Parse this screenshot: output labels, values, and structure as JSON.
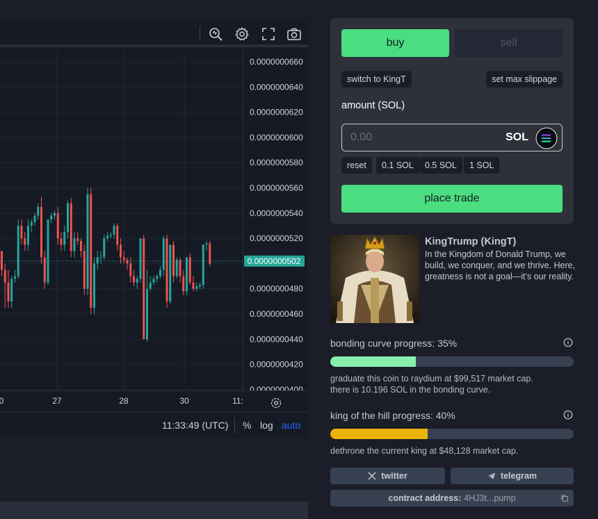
{
  "chart": {
    "price_ticks": [
      "0.0000000660",
      "0.0000000640",
      "0.0000000620",
      "0.0000000600",
      "0.0000000580",
      "0.0000000560",
      "0.0000000540",
      "0.0000000520",
      "0.0000000500",
      "0.0000000480",
      "0.0000000460",
      "0.0000000440",
      "0.0000000420",
      "0.0000000400"
    ],
    "current_price": "0.0000000502",
    "time_labels": [
      "0",
      "27",
      "28",
      "30",
      "11:"
    ],
    "clock": "11:33:49 (UTC)",
    "percent_label": "%",
    "log_label": "log",
    "auto_label": "auto",
    "colors": {
      "up": "#26a69a",
      "down": "#ef5350",
      "price_badge": "#26a69a"
    },
    "icons": [
      "indicator-search-icon",
      "gear-icon",
      "fullscreen-icon",
      "camera-icon"
    ]
  },
  "chart_data": {
    "type": "candlestick",
    "ylim": [
      4e-08,
      6.6e-08
    ],
    "candles": [
      {
        "o": 51.0,
        "h": 51.0,
        "l": 49.0,
        "c": 49.5
      },
      {
        "o": 49.5,
        "h": 50.0,
        "l": 46.5,
        "c": 48.5
      },
      {
        "o": 48.5,
        "h": 49.5,
        "l": 46.5,
        "c": 47.0
      },
      {
        "o": 47.0,
        "h": 49.0,
        "l": 46.5,
        "c": 48.8
      },
      {
        "o": 48.8,
        "h": 49.5,
        "l": 48.5,
        "c": 49.0
      },
      {
        "o": 49.0,
        "h": 53.5,
        "l": 48.8,
        "c": 53.0
      },
      {
        "o": 53.0,
        "h": 53.5,
        "l": 51.5,
        "c": 52.0
      },
      {
        "o": 52.0,
        "h": 52.5,
        "l": 51.0,
        "c": 51.5
      },
      {
        "o": 51.5,
        "h": 53.5,
        "l": 51.0,
        "c": 53.0
      },
      {
        "o": 53.0,
        "h": 53.5,
        "l": 52.5,
        "c": 53.3
      },
      {
        "o": 53.3,
        "h": 54.0,
        "l": 53.0,
        "c": 53.8
      },
      {
        "o": 53.8,
        "h": 54.8,
        "l": 53.5,
        "c": 54.5
      },
      {
        "o": 54.5,
        "h": 55.3,
        "l": 50.0,
        "c": 50.5
      },
      {
        "o": 50.5,
        "h": 51.0,
        "l": 48.0,
        "c": 48.5
      },
      {
        "o": 48.5,
        "h": 53.5,
        "l": 48.3,
        "c": 53.5
      },
      {
        "o": 53.5,
        "h": 54.0,
        "l": 53.2,
        "c": 53.8
      },
      {
        "o": 53.8,
        "h": 54.2,
        "l": 53.5,
        "c": 54.0
      },
      {
        "o": 54.0,
        "h": 54.5,
        "l": 51.5,
        "c": 52.0
      },
      {
        "o": 52.0,
        "h": 52.5,
        "l": 51.0,
        "c": 51.5
      },
      {
        "o": 51.5,
        "h": 53.0,
        "l": 51.0,
        "c": 52.5
      },
      {
        "o": 52.5,
        "h": 55.0,
        "l": 52.0,
        "c": 54.8
      },
      {
        "o": 54.8,
        "h": 55.2,
        "l": 50.5,
        "c": 51.0
      },
      {
        "o": 51.0,
        "h": 52.5,
        "l": 50.5,
        "c": 52.0
      },
      {
        "o": 52.0,
        "h": 52.5,
        "l": 51.5,
        "c": 51.8
      },
      {
        "o": 51.8,
        "h": 52.0,
        "l": 50.5,
        "c": 51.0
      },
      {
        "o": 51.0,
        "h": 51.5,
        "l": 47.5,
        "c": 48.0
      },
      {
        "o": 48.0,
        "h": 56.0,
        "l": 47.5,
        "c": 55.5
      },
      {
        "o": 55.5,
        "h": 56.0,
        "l": 46.0,
        "c": 46.5
      },
      {
        "o": 46.5,
        "h": 50.5,
        "l": 46.0,
        "c": 50.0
      },
      {
        "o": 50.0,
        "h": 51.0,
        "l": 49.5,
        "c": 50.5
      },
      {
        "o": 50.5,
        "h": 51.0,
        "l": 50.0,
        "c": 50.5
      },
      {
        "o": 50.5,
        "h": 52.3,
        "l": 50.3,
        "c": 52.0
      },
      {
        "o": 52.0,
        "h": 52.5,
        "l": 51.8,
        "c": 52.2
      },
      {
        "o": 52.2,
        "h": 52.5,
        "l": 52.0,
        "c": 52.3
      },
      {
        "o": 52.3,
        "h": 53.2,
        "l": 52.0,
        "c": 53.0
      },
      {
        "o": 53.0,
        "h": 53.2,
        "l": 51.0,
        "c": 51.5
      },
      {
        "o": 51.5,
        "h": 52.0,
        "l": 50.0,
        "c": 50.5
      },
      {
        "o": 50.5,
        "h": 51.0,
        "l": 50.0,
        "c": 50.3
      },
      {
        "o": 50.3,
        "h": 50.5,
        "l": 49.5,
        "c": 50.0
      },
      {
        "o": 50.0,
        "h": 50.5,
        "l": 48.5,
        "c": 49.0
      },
      {
        "o": 49.0,
        "h": 49.5,
        "l": 48.2,
        "c": 48.5
      },
      {
        "o": 48.5,
        "h": 49.0,
        "l": 48.0,
        "c": 48.8
      },
      {
        "o": 48.8,
        "h": 52.0,
        "l": 48.5,
        "c": 52.0
      },
      {
        "o": 52.0,
        "h": 52.3,
        "l": 44.0,
        "c": 44.0
      },
      {
        "o": 44.0,
        "h": 49.5,
        "l": 43.8,
        "c": 48.0
      },
      {
        "o": 48.0,
        "h": 49.0,
        "l": 47.8,
        "c": 48.5
      },
      {
        "o": 48.5,
        "h": 49.0,
        "l": 48.3,
        "c": 48.8
      },
      {
        "o": 48.8,
        "h": 49.2,
        "l": 48.5,
        "c": 49.0
      },
      {
        "o": 49.0,
        "h": 49.8,
        "l": 48.8,
        "c": 49.5
      },
      {
        "o": 49.5,
        "h": 52.2,
        "l": 49.0,
        "c": 52.0
      },
      {
        "o": 52.0,
        "h": 52.3,
        "l": 46.5,
        "c": 47.0
      },
      {
        "o": 47.0,
        "h": 51.5,
        "l": 46.8,
        "c": 51.5
      },
      {
        "o": 51.5,
        "h": 51.8,
        "l": 48.5,
        "c": 49.0
      },
      {
        "o": 49.0,
        "h": 50.5,
        "l": 48.8,
        "c": 50.3
      },
      {
        "o": 50.3,
        "h": 50.5,
        "l": 48.5,
        "c": 49.0
      },
      {
        "o": 49.0,
        "h": 49.5,
        "l": 47.5,
        "c": 47.8
      },
      {
        "o": 47.8,
        "h": 50.5,
        "l": 47.5,
        "c": 50.5
      },
      {
        "o": 50.5,
        "h": 50.8,
        "l": 48.3,
        "c": 48.5
      },
      {
        "o": 48.5,
        "h": 49.0,
        "l": 47.8,
        "c": 48.0
      },
      {
        "o": 48.0,
        "h": 48.5,
        "l": 47.8,
        "c": 48.2
      },
      {
        "o": 48.2,
        "h": 48.5,
        "l": 48.0,
        "c": 48.3
      },
      {
        "o": 48.3,
        "h": 51.5,
        "l": 48.0,
        "c": 51.5
      },
      {
        "o": 51.5,
        "h": 51.8,
        "l": 51.0,
        "c": 51.6
      },
      {
        "o": 51.6,
        "h": 51.8,
        "l": 49.8,
        "c": 50.0
      }
    ]
  },
  "trade": {
    "buy_label": "buy",
    "sell_label": "sell",
    "switch_label": "switch to KingT",
    "slippage_label": "set max slippage",
    "amount_label": "amount (SOL)",
    "amount_placeholder": "0.00",
    "currency": "SOL",
    "quick": [
      "reset",
      "0.1 SOL",
      "0.5 SOL",
      "1 SOL"
    ],
    "place_label": "place trade",
    "colors": {
      "accent": "#4ade80"
    }
  },
  "token": {
    "title": "KingTrump (KingT)",
    "description": "In the Kingdom of Donald Trump, we build, we conquer, and we thrive. Here, greatness is not a goal—it's our reality."
  },
  "bonding": {
    "label": "bonding curve progress: 35%",
    "progress": 35,
    "note1": "graduate this coin to raydium at $99,517 market cap.",
    "note2": "there is 10.196 SOL in the bonding curve.",
    "color": "#86efac"
  },
  "koth": {
    "label": "king of the hill progress: 40%",
    "progress": 40,
    "note": "dethrone the current king at $48,128 market cap.",
    "color": "#eab308"
  },
  "social": {
    "twitter": "twitter",
    "telegram": "telegram",
    "contract_label": "contract address:",
    "contract_value": "4HJ3t...pump"
  }
}
